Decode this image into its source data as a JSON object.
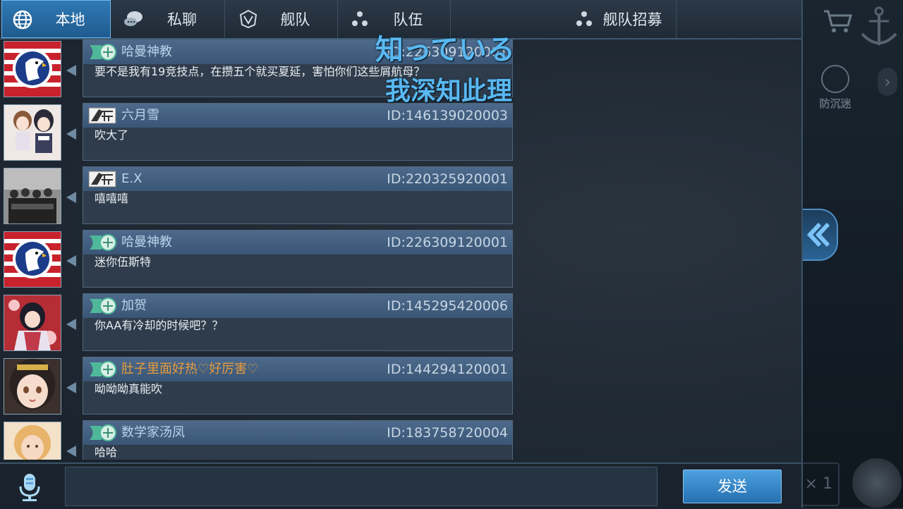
{
  "tabs": [
    {
      "label": "本地",
      "icon": "globe-icon",
      "active": true
    },
    {
      "label": "私聊",
      "icon": "chat-bubbles-icon",
      "active": false
    },
    {
      "label": "舰队",
      "icon": "fleet-emblem-icon",
      "active": false
    },
    {
      "label": "队伍",
      "icon": "team-dots-icon",
      "active": false
    },
    {
      "label": "舰队招募",
      "icon": "team-dots-icon",
      "active": false
    }
  ],
  "overlay": {
    "line1": "知っている",
    "line2": "我深知此理"
  },
  "messages": [
    {
      "name": "哈曼神教",
      "id": "ID:226309120001",
      "text": "要不是我有19竞技点，在攒五个就买夏延，害怕你们这些屑航母？",
      "badge": "green-emblem",
      "avatar": "eagle-flag-avatar"
    },
    {
      "name": "六月雪",
      "id": "ID:146139020003",
      "text": "吹大了",
      "badge": "white-wing",
      "avatar": "anime-girls-avatar"
    },
    {
      "name": "E.X",
      "id": "ID:220325920001",
      "text": "嘻嘻嘻",
      "badge": "white-wing",
      "avatar": "old-photo-avatar"
    },
    {
      "name": "哈曼神教",
      "id": "ID:226309120001",
      "text": "迷你伍斯特",
      "badge": "green-emblem",
      "avatar": "eagle-flag-avatar"
    },
    {
      "name": "加贺",
      "id": "ID:145295420006",
      "text": "你AA有冷却的时候吧？？",
      "badge": "green-emblem",
      "avatar": "kimono-girl-avatar"
    },
    {
      "name": "肚子里面好热♡好厉害♡",
      "id": "ID:144294120001",
      "text": "呦呦呦真能吹",
      "badge": "green-emblem",
      "avatar": "anime-face-avatar",
      "name_color": "#e69a3a"
    },
    {
      "name": "数学家汤凤",
      "id": "ID:183758720004",
      "text": "哈哈",
      "badge": "green-emblem",
      "avatar": "blonde-girl-avatar"
    }
  ],
  "input": {
    "value": ""
  },
  "send_label": "发送",
  "right_panel": {
    "aa_label": "防沉迷",
    "count": "× 1"
  }
}
